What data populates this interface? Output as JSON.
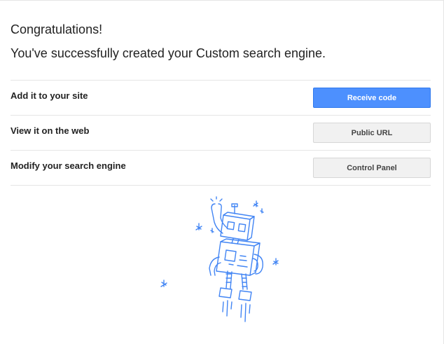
{
  "header": {
    "title": "Congratulations!",
    "subtitle": "You've successfully created your Custom search engine."
  },
  "rows": [
    {
      "label": "Add it to your site",
      "button": "Receive code"
    },
    {
      "label": "View it on the web",
      "button": "Public URL"
    },
    {
      "label": "Modify your search engine",
      "button": "Control Panel"
    }
  ],
  "colors": {
    "primary_button": "#4d90fe",
    "default_button": "#f1f1f1",
    "illustration": "#4285f4"
  },
  "illustration": {
    "icon": "celebrating-robot-illustration"
  }
}
